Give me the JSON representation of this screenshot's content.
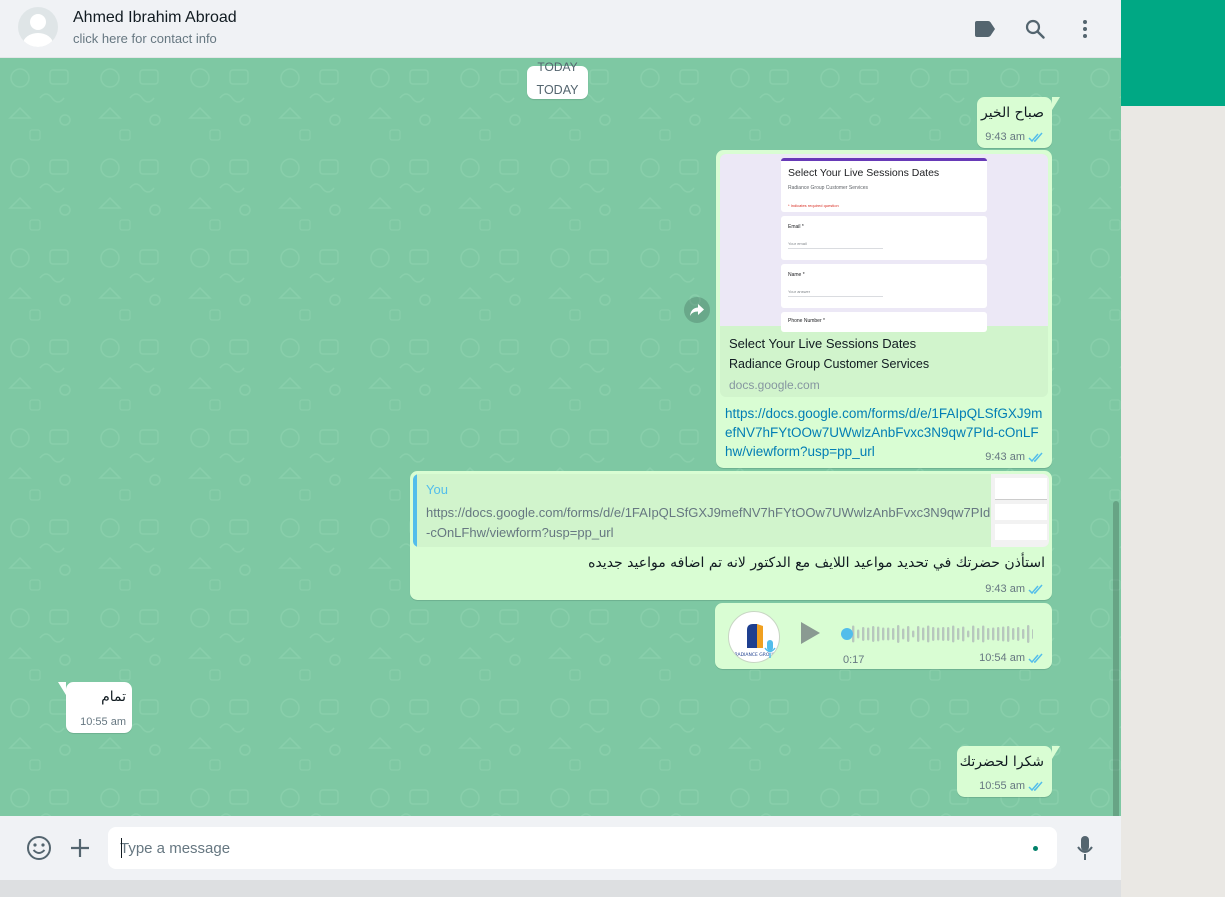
{
  "header": {
    "contact_name": "Ahmed Ibrahim Abroad",
    "contact_subtitle": "click here for contact info",
    "icons": [
      "label-icon",
      "search-icon",
      "menu-icon"
    ]
  },
  "chat": {
    "date_chip_ghost": "TODAY",
    "date_chip": "TODAY",
    "messages": [
      {
        "direction": "out",
        "text": "صباح الخير",
        "time": "9:43 am"
      },
      {
        "direction": "out",
        "preview": {
          "form_title": "Select Your Live Sessions Dates",
          "form_subtitle": "Radiance Group Customer Services",
          "form_required": "* Indicates required question",
          "field_email": "Email *",
          "field_email_placeholder": "Your email",
          "field_name": "Name *",
          "field_name_placeholder": "Your answer",
          "field_phone": "Phone Number *",
          "title": "Select Your Live Sessions Dates",
          "description": "Radiance Group Customer Services",
          "domain": "docs.google.com"
        },
        "link": "https://docs.google.com/forms/d/e/1FAIpQLSfGXJ9mefNV7hFYtOOw7UWwlzAnbFvxc3N9qw7PId-cOnLFhw/viewform?usp=pp_url",
        "time": "9:43 am"
      },
      {
        "direction": "out",
        "quote": {
          "author": "You",
          "text": "https://docs.google.com/forms/d/e/1FAIpQLSfGXJ9mefNV7hFYtOOw7UWwlzAnbFvxc3N9qw7PId-cOnLFhw/viewform?usp=pp_url"
        },
        "text": "استأذن حضرتك في تحديد مواعيد اللايف مع الدكتور لانه تم اضافه مواعيد جديده",
        "time": "9:43 am"
      },
      {
        "direction": "out",
        "type": "voice",
        "duration": "0:17",
        "progress": 0,
        "avatar_text": "RADIANCE GROUP",
        "time": "10:54 am"
      },
      {
        "direction": "in",
        "text": "تمام",
        "time": "10:55 am"
      },
      {
        "direction": "out",
        "text": "شكرا لحضرتك",
        "time": "10:55 am"
      }
    ]
  },
  "footer": {
    "placeholder": "Type a message",
    "icons": [
      "emoji-icon",
      "plus-icon",
      "microphone-icon"
    ]
  },
  "colors": {
    "accent": "#00a884",
    "outgoing_bubble": "#d9fdd3",
    "chat_background": "#7ec8a3",
    "link": "#027eb5",
    "read_ticks": "#53bdeb"
  }
}
